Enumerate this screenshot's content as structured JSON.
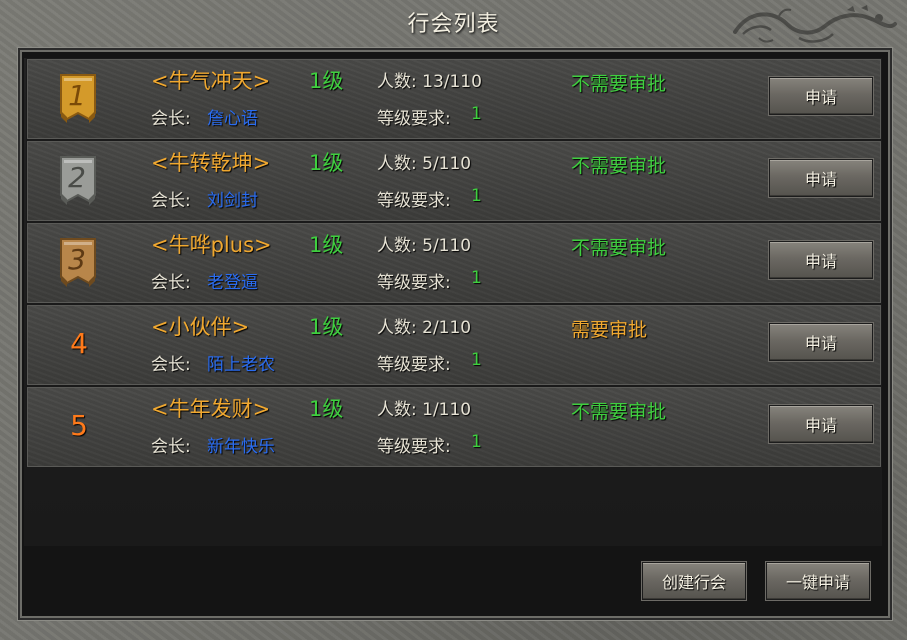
{
  "window": {
    "title": "行会列表"
  },
  "colors": {
    "no_approval": "#3fcf3f",
    "approval": "#f0a830",
    "guild_name": "#f0a830",
    "leader_name": "#2a6cf0",
    "level": "#3fcf3f",
    "rank_number": "#ff7a1a"
  },
  "guilds": [
    {
      "rank": "1",
      "rank_style": "gold-banner",
      "name": "<牛气冲天>",
      "level": "1级",
      "members": "人数: 13/110",
      "approval": "不需要审批",
      "approval_required": false,
      "leader_label": "会长:",
      "leader": "詹心语",
      "req_label": "等级要求:",
      "req_value": "1",
      "apply_label": "申请"
    },
    {
      "rank": "2",
      "rank_style": "silver-banner",
      "name": "<牛转乾坤>",
      "level": "1级",
      "members": "人数: 5/110",
      "approval": "不需要审批",
      "approval_required": false,
      "leader_label": "会长:",
      "leader": "刘剑封",
      "req_label": "等级要求:",
      "req_value": "1",
      "apply_label": "申请"
    },
    {
      "rank": "3",
      "rank_style": "bronze-banner",
      "name": "<牛哗plus>",
      "level": "1级",
      "members": "人数: 5/110",
      "approval": "不需要审批",
      "approval_required": false,
      "leader_label": "会长:",
      "leader": "老登逼",
      "req_label": "等级要求:",
      "req_value": "1",
      "apply_label": "申请"
    },
    {
      "rank": "4",
      "rank_style": "number",
      "name": "<小伙伴>",
      "level": "1级",
      "members": "人数: 2/110",
      "approval": "需要审批",
      "approval_required": true,
      "leader_label": "会长:",
      "leader": "陌上老农",
      "req_label": "等级要求:",
      "req_value": "1",
      "apply_label": "申请"
    },
    {
      "rank": "5",
      "rank_style": "number",
      "name": "<牛年发财>",
      "level": "1级",
      "members": "人数: 1/110",
      "approval": "不需要审批",
      "approval_required": false,
      "leader_label": "会长:",
      "leader": "新年快乐",
      "req_label": "等级要求:",
      "req_value": "1",
      "apply_label": "申请"
    }
  ],
  "footer": {
    "create_label": "创建行会",
    "apply_all_label": "一键申请"
  }
}
